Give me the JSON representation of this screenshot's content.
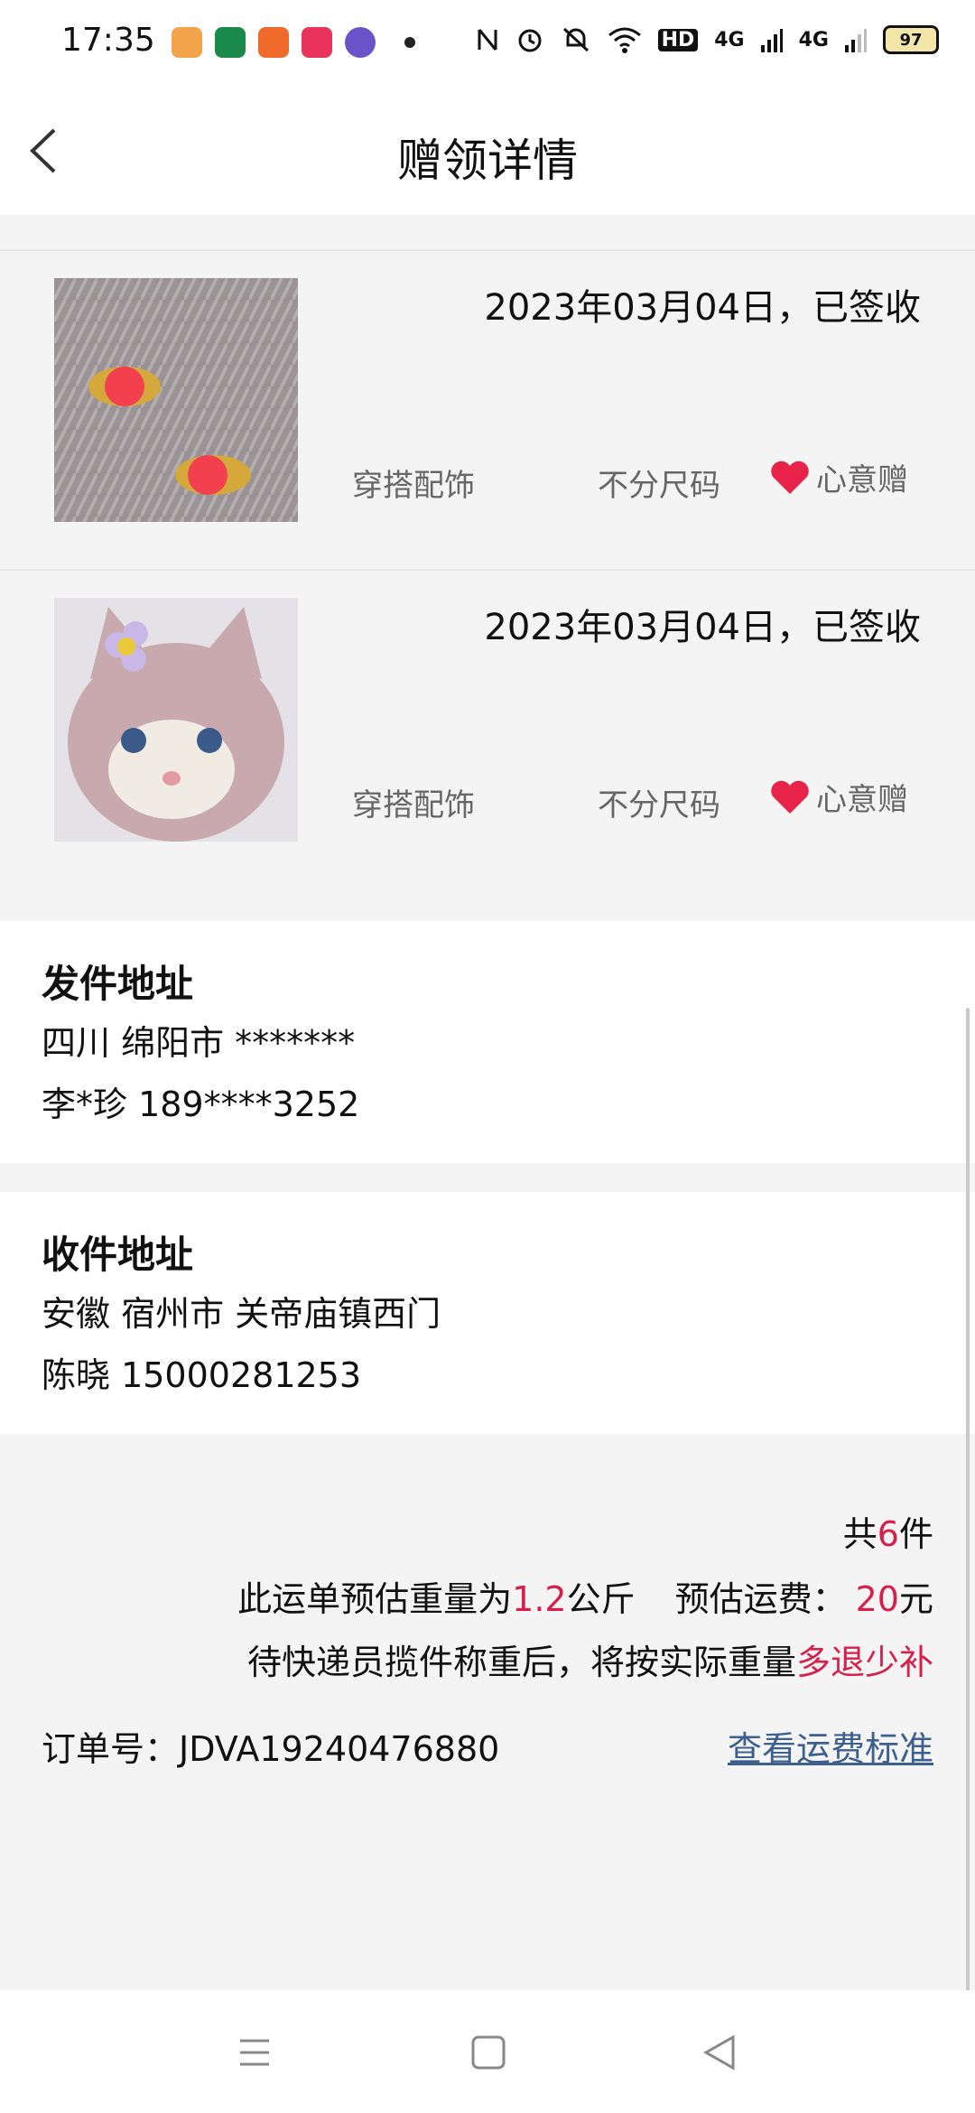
{
  "status_bar": {
    "time": "17:35",
    "network1": "4G",
    "network2": "4G",
    "hd": "HD",
    "battery": "97"
  },
  "header": {
    "title": "赠领详情"
  },
  "items": [
    {
      "date_status": "2023年03月04日，已签收",
      "category": "穿搭配饰",
      "size": "不分尺码",
      "gift_type": "心意赠"
    },
    {
      "date_status": "2023年03月04日，已签收",
      "category": "穿搭配饰",
      "size": "不分尺码",
      "gift_type": "心意赠"
    }
  ],
  "sender": {
    "title": "发件地址",
    "address": "四川 绵阳市 *******",
    "contact": "李*珍 189****3252"
  },
  "receiver": {
    "title": "收件地址",
    "address": "安徽 宿州市 关帝庙镇西门",
    "contact": "陈晓 15000281253"
  },
  "summary": {
    "total_prefix": "共",
    "total_count": "6",
    "total_suffix": "件",
    "weight_prefix": "此运单预估重量为",
    "weight_value": "1.2",
    "weight_unit": "公斤",
    "fee_prefix": "预估运费：",
    "fee_value": "20",
    "fee_unit": "元",
    "note_prefix": "待快递员揽件称重后，将按实际重量",
    "note_highlight": "多退少补",
    "order_label": "订单号：JDVA19240476880",
    "fee_standard_link": "查看运费标准"
  },
  "colors": {
    "accent_red": "#d81e4a",
    "link_blue": "#3b5f8f",
    "heart": "#e8234a"
  },
  "icons": [
    "back-arrow-icon",
    "heart-icon",
    "menu-icon",
    "home-square-icon",
    "back-triangle-icon",
    "alarm-icon",
    "wifi-icon",
    "mute-icon"
  ]
}
